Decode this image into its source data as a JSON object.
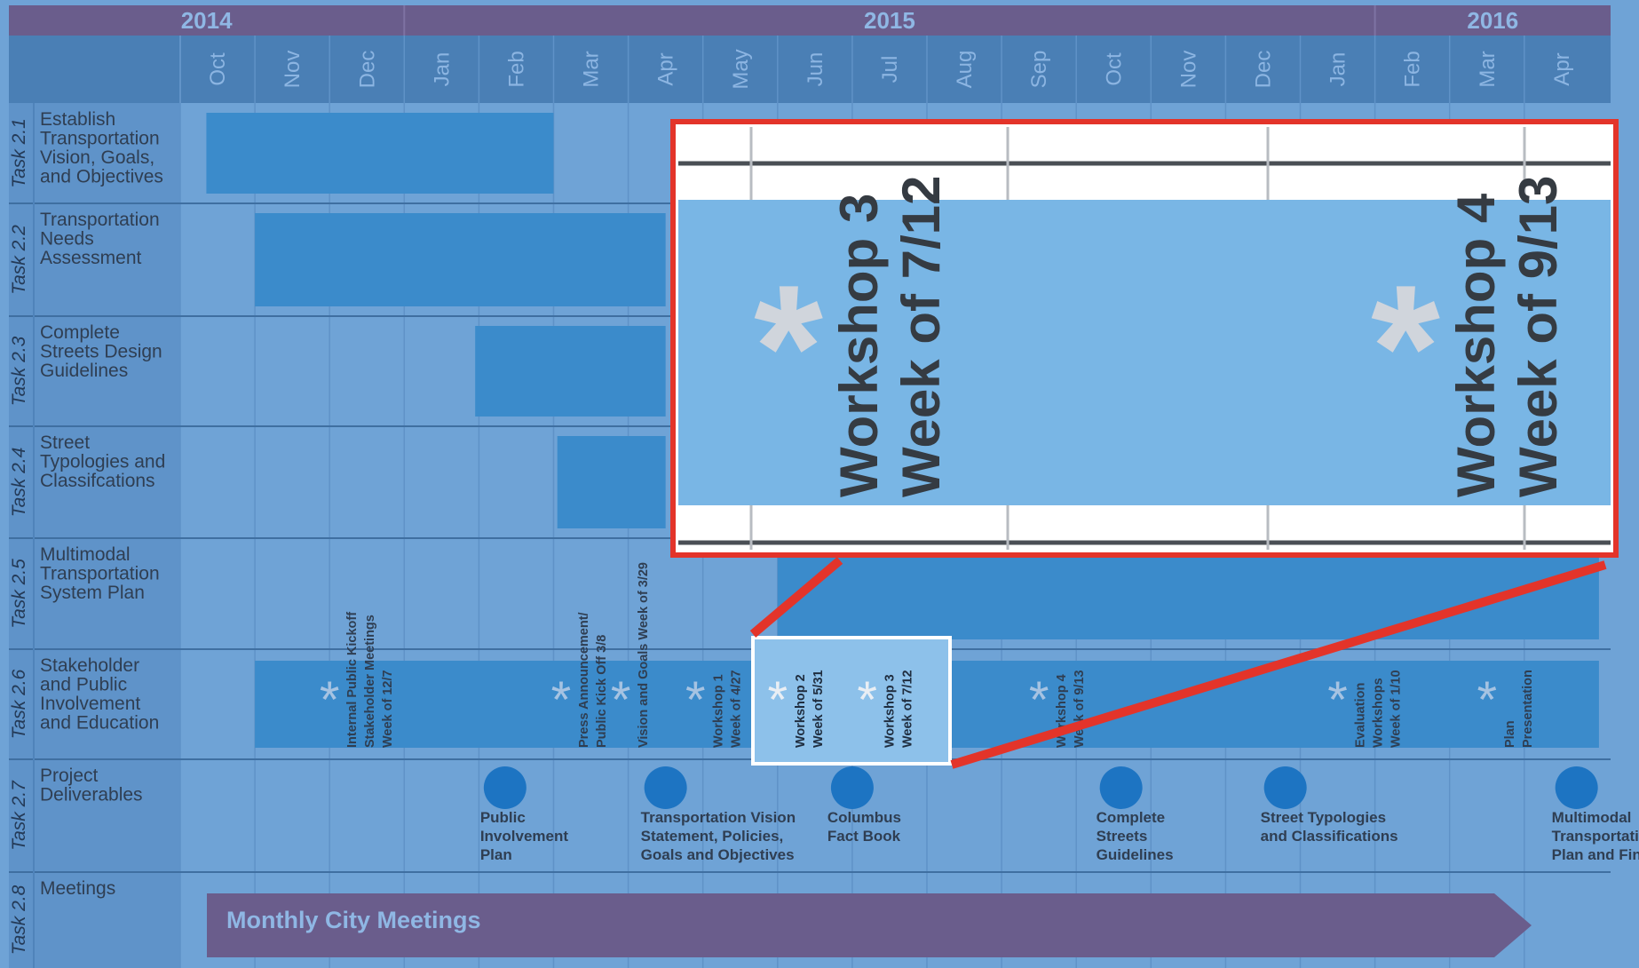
{
  "chart_data": {
    "type": "gantt",
    "years": [
      "2014",
      "2015",
      "2016"
    ],
    "months": [
      "Oct",
      "Nov",
      "Dec",
      "Jan",
      "Feb",
      "Mar",
      "Apr",
      "May",
      "Jun",
      "Jul",
      "Aug",
      "Sep",
      "Oct",
      "Nov",
      "Dec",
      "Jan",
      "Feb",
      "Mar",
      "Apr"
    ],
    "tasks": [
      {
        "id": "Task 2.1",
        "label": [
          "Establish",
          "Transportation",
          "Vision, Goals,",
          "and Objectives"
        ],
        "start": 0.35,
        "end": 5.0
      },
      {
        "id": "Task 2.2",
        "label": [
          "Transportation",
          "Needs",
          "Assessment"
        ],
        "start": 1.0,
        "end": 6.5
      },
      {
        "id": "Task 2.3",
        "label": [
          "Complete",
          "Streets Design",
          "Guidelines"
        ],
        "start": 3.95,
        "end": 6.5
      },
      {
        "id": "Task 2.4",
        "label": [
          "Street",
          "Typologies and",
          "Classifcations"
        ],
        "start": 5.05,
        "end": 6.5
      },
      {
        "id": "Task 2.5",
        "label": [
          "Multimodal",
          "Transportation",
          "System Plan"
        ],
        "start": 8.0,
        "end": 19.0
      },
      {
        "id": "Task 2.6",
        "label": [
          "Stakeholder",
          "and Public",
          "Involvement",
          "and Education"
        ],
        "start": 1.0,
        "end": 19.0
      },
      {
        "id": "Task 2.7",
        "label": [
          "Project",
          "Deliverables"
        ]
      },
      {
        "id": "Task 2.8",
        "label": [
          "Meetings"
        ]
      }
    ],
    "events": [
      {
        "month": 2.0,
        "lines": [
          "Internal Public Kickoff",
          "Stakeholder Meetings",
          "Week of 12/7"
        ]
      },
      {
        "month": 5.1,
        "lines": [
          "Press Announcement/",
          "Public Kick Off 3/8"
        ]
      },
      {
        "month": 5.9,
        "lines": [
          "Vision and Goals Week of 3/29"
        ]
      },
      {
        "month": 6.9,
        "lines": [
          "Workshop 1",
          "Week of 4/27"
        ]
      },
      {
        "month": 8.0,
        "lines": [
          "Workshop 2",
          "Week of 5/31"
        ]
      },
      {
        "month": 9.2,
        "lines": [
          "Workshop 3",
          "Week of 7/12"
        ]
      },
      {
        "month": 11.5,
        "lines": [
          "Workshop 4",
          "Week of 9/13"
        ]
      },
      {
        "month": 15.5,
        "lines": [
          "Evaluation",
          "Workshops",
          "Week of 1/10"
        ]
      },
      {
        "month": 17.5,
        "lines": [
          "Plan",
          "Presentation"
        ]
      }
    ],
    "deliverables": [
      {
        "month": 4.35,
        "lines": [
          "Public",
          "Involvement",
          "Plan"
        ]
      },
      {
        "month": 6.5,
        "lines": [
          "Transportation Vision",
          "Statement, Policies,",
          "Goals and Objectives"
        ]
      },
      {
        "month": 9.0,
        "lines": [
          "Columbus",
          "Fact Book"
        ]
      },
      {
        "month": 12.6,
        "lines": [
          "Complete",
          "Streets",
          "Guidelines"
        ]
      },
      {
        "month": 14.8,
        "lines": [
          "Street Typologies",
          "and Classifications"
        ]
      },
      {
        "month": 18.7,
        "lines": [
          "Multimodal",
          "Transportation System",
          "Plan and Final Report"
        ]
      }
    ],
    "meetings_label": "Monthly City Meetings",
    "zoom": {
      "events": [
        {
          "month": 9.2,
          "lines": [
            "Workshop 3",
            "Week of 7/12"
          ]
        },
        {
          "month": 11.5,
          "lines": [
            "Workshop 4",
            "Week of 9/13"
          ]
        }
      ]
    }
  },
  "colors": {
    "background": "#6fa3d6",
    "header": "#4a7fb5",
    "year_band": "#6a5d8c",
    "label_col": "#5f93c9",
    "bar": "#3b8bcb",
    "dot": "#1d74c2",
    "meeting_arrow": "#6a5d8c",
    "text_dark": "#2f3e52",
    "zoom_border": "#e3342a",
    "zoom_fill": "#79b6e5",
    "asterisk": "#d0d5dc"
  }
}
